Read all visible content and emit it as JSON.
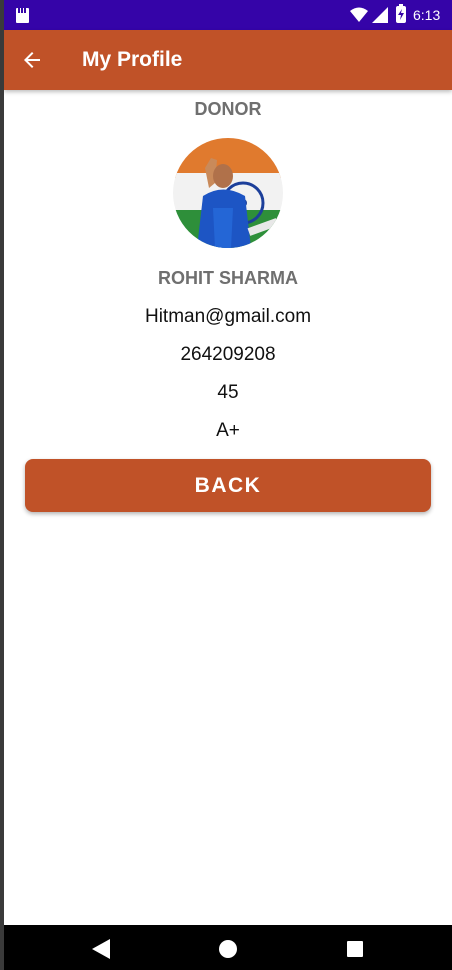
{
  "status_bar": {
    "time": "6:13",
    "icons": [
      "sd-card-icon",
      "wifi-icon",
      "signal-icon",
      "battery-charging-icon"
    ]
  },
  "toolbar": {
    "back_icon": "arrow-left-icon",
    "title": "My Profile"
  },
  "profile": {
    "role": "DONOR",
    "avatar": "profile-photo",
    "name": "ROHIT SHARMA",
    "email": "Hitman@gmail.com",
    "phone": "264209208",
    "age": "45",
    "blood_group": "A+"
  },
  "actions": {
    "back_label": "BACK"
  },
  "nav_bar": {
    "icons": [
      "nav-back-icon",
      "nav-home-icon",
      "nav-recents-icon"
    ]
  },
  "colors": {
    "status_bar": "#3504a8",
    "primary": "#c05228",
    "label_gray": "#6f6f6f",
    "text": "#111111"
  }
}
